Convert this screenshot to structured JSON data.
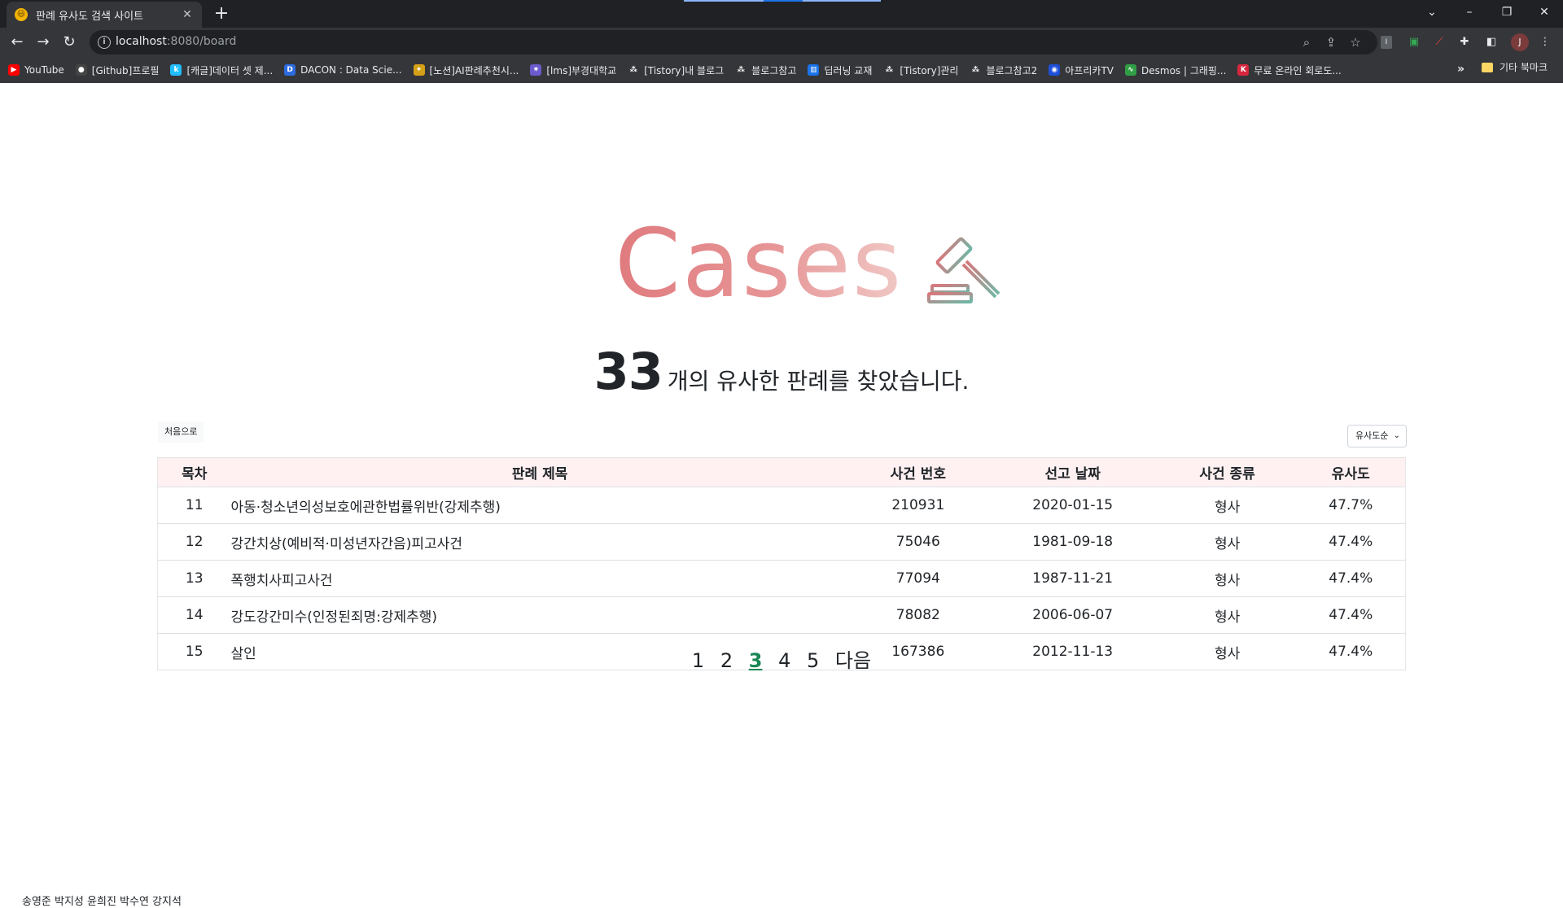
{
  "browser": {
    "tab_title": "판례 유사도 검색 사이트",
    "tab_favicon": "😃",
    "url_host": "localhost",
    "url_rest": ":8080/board",
    "bookmarks": [
      {
        "icon": "youtube-icon",
        "color": "#ff0000",
        "glyph": "▶",
        "label": "YouTube"
      },
      {
        "icon": "github-icon",
        "color": "#444444",
        "glyph": "●",
        "label": "[Github]프로필"
      },
      {
        "icon": "kaggle-icon",
        "color": "#20beff",
        "glyph": "k",
        "label": "[캐글]데이터 셋 제..."
      },
      {
        "icon": "dacon-icon",
        "color": "#2d6cdf",
        "glyph": "D",
        "label": "DACON : Data Scie..."
      },
      {
        "icon": "bulb-icon",
        "color": "#d4a017",
        "glyph": "✦",
        "label": "[노션]AI판례추천시..."
      },
      {
        "icon": "lms-icon",
        "color": "#6a5acd",
        "glyph": "✷",
        "label": "[lms]부경대학교"
      },
      {
        "icon": "tistory-icon",
        "color": "#35363a",
        "glyph": "⁂",
        "label": "[Tistory]내 블로그"
      },
      {
        "icon": "tistory-icon",
        "color": "#35363a",
        "glyph": "⁂",
        "label": "블로그참고"
      },
      {
        "icon": "book-icon",
        "color": "#1a73e8",
        "glyph": "▥",
        "label": "딥러닝 교재"
      },
      {
        "icon": "tistory-icon",
        "color": "#35363a",
        "glyph": "⁂",
        "label": "[Tistory]관리"
      },
      {
        "icon": "tistory-icon",
        "color": "#35363a",
        "glyph": "⁂",
        "label": "블로그참고2"
      },
      {
        "icon": "afreeca-icon",
        "color": "#1e4fd8",
        "glyph": "◉",
        "label": "아프리카TV"
      },
      {
        "icon": "desmos-icon",
        "color": "#2f9e44",
        "glyph": "∿",
        "label": "Desmos | 그래핑..."
      },
      {
        "icon": "k-icon",
        "color": "#d7263d",
        "glyph": "K",
        "label": "무료 온라인 회로도..."
      }
    ],
    "more_bookmarks": "»",
    "other_bookmarks": "기타 북마크"
  },
  "page": {
    "logo_text": "Cases",
    "result_count": "33",
    "result_suffix": "개의 유사한 판례를 찾았습니다.",
    "home_button": "처음으로",
    "sort_label": "유사도순",
    "table": {
      "headers": [
        "목차",
        "판례 제목",
        "사건 번호",
        "선고 날짜",
        "사건 종류",
        "유사도"
      ],
      "rows": [
        [
          "11",
          "아동·청소년의성보호에관한법률위반(강제추행)",
          "210931",
          "2020-01-15",
          "형사",
          "47.7%"
        ],
        [
          "12",
          "강간치상(예비적·미성년자간음)피고사건",
          "75046",
          "1981-09-18",
          "형사",
          "47.4%"
        ],
        [
          "13",
          "폭행치사피고사건",
          "77094",
          "1987-11-21",
          "형사",
          "47.4%"
        ],
        [
          "14",
          "강도강간미수(인정된죄명:강제추행)",
          "78082",
          "2006-06-07",
          "형사",
          "47.4%"
        ],
        [
          "15",
          "살인",
          "167386",
          "2012-11-13",
          "형사",
          "47.4%"
        ]
      ]
    },
    "pagination": [
      "1",
      "2",
      "3",
      "4",
      "5",
      "다음"
    ],
    "current_page": "3",
    "footer": "송영준 박지성 윤희진 박수연 강지석"
  }
}
